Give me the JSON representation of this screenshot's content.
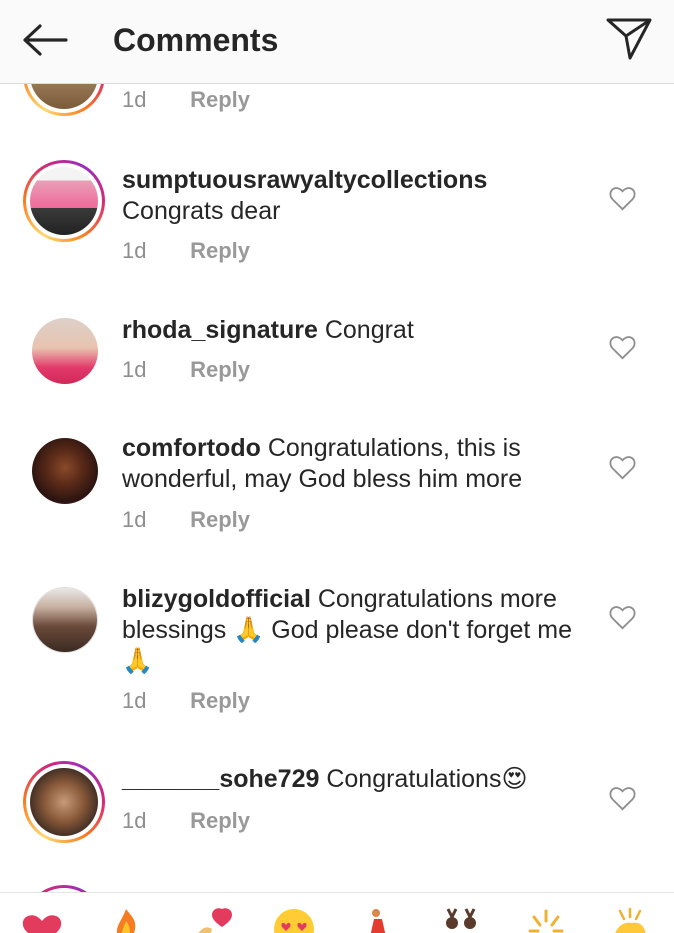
{
  "header": {
    "title": "Comments",
    "back_icon": "back-arrow-icon",
    "send_icon": "direct-send-icon"
  },
  "comments": [
    {
      "username": "",
      "text": "",
      "time": "1d",
      "reply": "Reply"
    },
    {
      "username": "sumptuousrawyaltycollections",
      "text": "Congrats dear",
      "time": "1d",
      "reply": "Reply"
    },
    {
      "username": "rhoda_signature",
      "text": "Congrat",
      "time": "1d",
      "reply": "Reply"
    },
    {
      "username": "comfortodo",
      "text": "Congratulations, this is wonderful, may God bless him more",
      "time": "1d",
      "reply": "Reply"
    },
    {
      "username": "blizygoldofficial",
      "text": "Congratulations more blessings 🙏 God please don't forget me 🙏",
      "time": "1d",
      "reply": "Reply"
    },
    {
      "username": "_______sohe729",
      "text": "Congratulations😍",
      "time": "1d",
      "reply": "Reply"
    }
  ],
  "emoji_bar": [
    "heart",
    "fire",
    "heart-hands",
    "heart-eyes",
    "dancer",
    "bunny-dancers",
    "sparkle",
    "clap"
  ],
  "colors": {
    "text": "#262626",
    "secondary": "#8e8e8e",
    "divider": "#dbdbdb"
  }
}
